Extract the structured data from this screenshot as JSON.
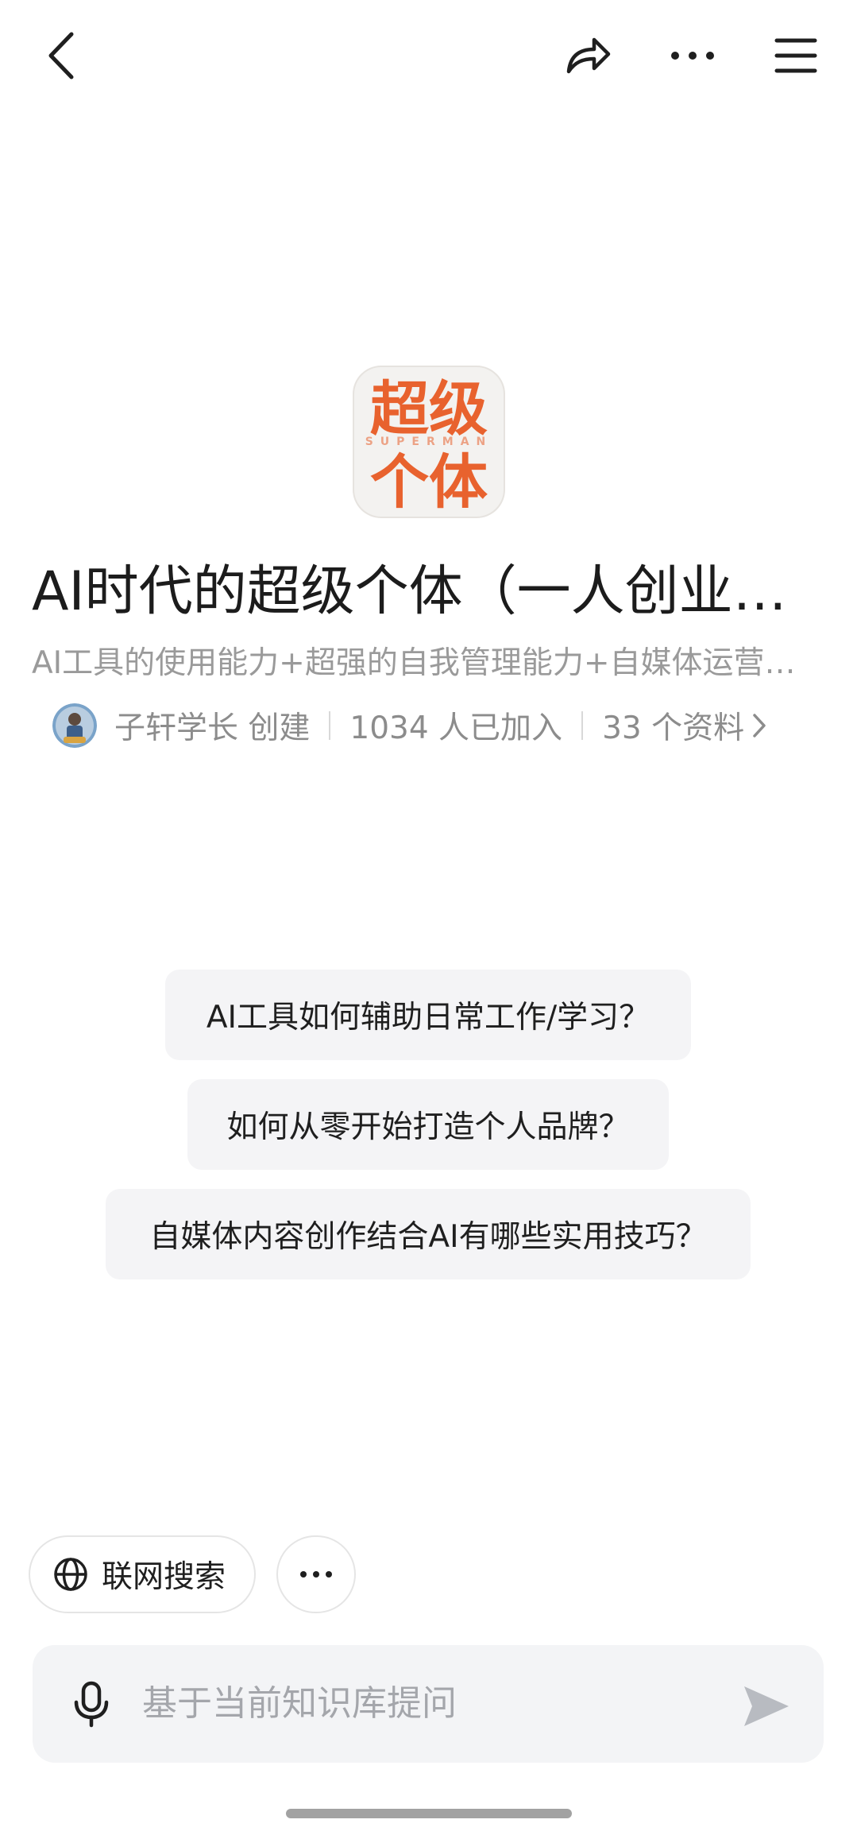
{
  "header": {
    "back_icon": "chevron-left-icon",
    "share_icon": "share-arrow-icon",
    "more_icon": "ellipsis-icon",
    "menu_icon": "hamburger-icon"
  },
  "cover": {
    "line1": "超级",
    "tag": "SUPERMAN",
    "line2": "个体",
    "accent": "#e8622e"
  },
  "knowledge_base": {
    "title": "AI时代的超级个体（一人创业…",
    "subtitle": "AI工具的使用能力+超强的自我管理能力+自媒体运营…",
    "creator": "子轩学长 创建",
    "members": "1034 人已加入",
    "files": "33 个资料"
  },
  "suggestions": [
    "AI工具如何辅助日常工作/学习？",
    "如何从零开始打造个人品牌？",
    "自媒体内容创作结合AI有哪些实用技巧？"
  ],
  "tools": {
    "web_search_label": "联网搜索"
  },
  "composer": {
    "placeholder": "基于当前知识库提问"
  }
}
